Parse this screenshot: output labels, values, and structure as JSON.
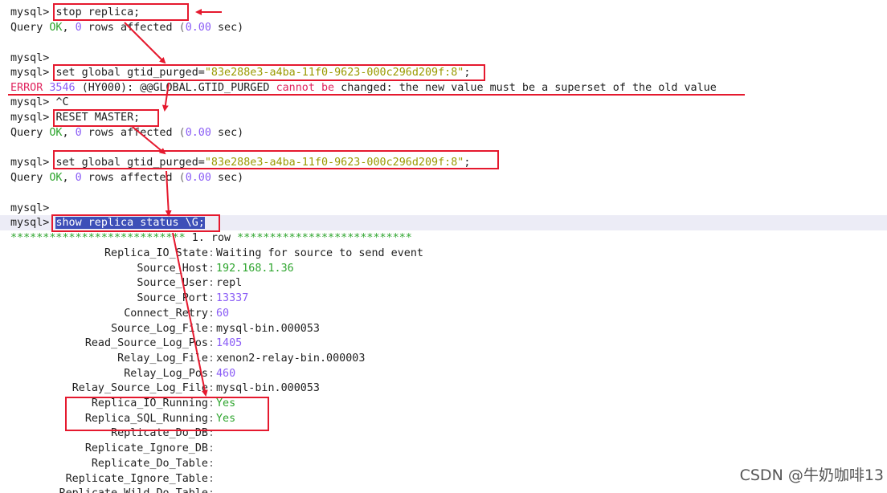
{
  "prompt": "mysql>",
  "cmd1": "stop replica;",
  "q1": {
    "pre": "Query ",
    "ok": "OK",
    "mid": ", ",
    "rows": "0",
    "rows_text": " rows affected ",
    "lp": "(",
    "time": "0.00",
    "rp": " sec)"
  },
  "cmd2_pre": "set global gtid_purged=",
  "cmd2_str": "\"83e288e3-a4ba-11f0-9623-000c296d209f:8\"",
  "cmd2_end": ";",
  "error": {
    "label": "ERROR",
    "code": " 3546 ",
    "state": "(HY000)",
    "colon": ": @@GLOBAL.GTID_PURGED ",
    "cannot": "cannot be",
    "msg": " changed: the new value must be a superset of the old value"
  },
  "ctrl_c": "^C",
  "cmd3": "RESET MASTER;",
  "cmd4_pre": "set global gtid_purged=",
  "cmd4_str": "\"83e288e3-a4ba-11f0-9623-000c296d209f:8\"",
  "cmd4_end": ";",
  "cmd5": "show replica status \\G;",
  "row_header": {
    "stars_left": "***************************",
    "row": " 1. row ",
    "stars_right": "***************************"
  },
  "fields": [
    {
      "name": "Replica_IO_State",
      "value": "Waiting for source to send event",
      "color": "plain"
    },
    {
      "name": "Source_Host",
      "value": "192.168.1.36",
      "color": "green"
    },
    {
      "name": "Source_User",
      "value": "repl",
      "color": "plain"
    },
    {
      "name": "Source_Port",
      "value": "13337",
      "color": "num"
    },
    {
      "name": "Connect_Retry",
      "value": "60",
      "color": "num"
    },
    {
      "name": "Source_Log_File",
      "value": "mysql-bin.000053",
      "color": "plain"
    },
    {
      "name": "Read_Source_Log_Pos",
      "value": "1405",
      "color": "num"
    },
    {
      "name": "Relay_Log_File",
      "value": "xenon2-relay-bin.000003",
      "color": "plain"
    },
    {
      "name": "Relay_Log_Pos",
      "value": "460",
      "color": "num"
    },
    {
      "name": "Relay_Source_Log_File",
      "value": "mysql-bin.000053",
      "color": "plain"
    },
    {
      "name": "Replica_IO_Running",
      "value": "Yes",
      "color": "green"
    },
    {
      "name": "Replica_SQL_Running",
      "value": "Yes",
      "color": "green"
    },
    {
      "name": "Replicate_Do_DB",
      "value": "",
      "color": "plain"
    },
    {
      "name": "Replicate_Ignore_DB",
      "value": "",
      "color": "plain"
    },
    {
      "name": "Replicate_Do_Table",
      "value": "",
      "color": "plain"
    },
    {
      "name": "Replicate_Ignore_Table",
      "value": "",
      "color": "plain"
    },
    {
      "name": "Replicate_Wild_Do_Table",
      "value": "",
      "color": "plain"
    }
  ],
  "watermark": "CSDN @牛奶咖啡13",
  "colors": {
    "annotation": "#e5192e",
    "ok": "#2ea52e",
    "number": "#8a5cf6",
    "error": "#e0245e",
    "string": "#9a9a00",
    "selection": "#3d4fb8"
  }
}
